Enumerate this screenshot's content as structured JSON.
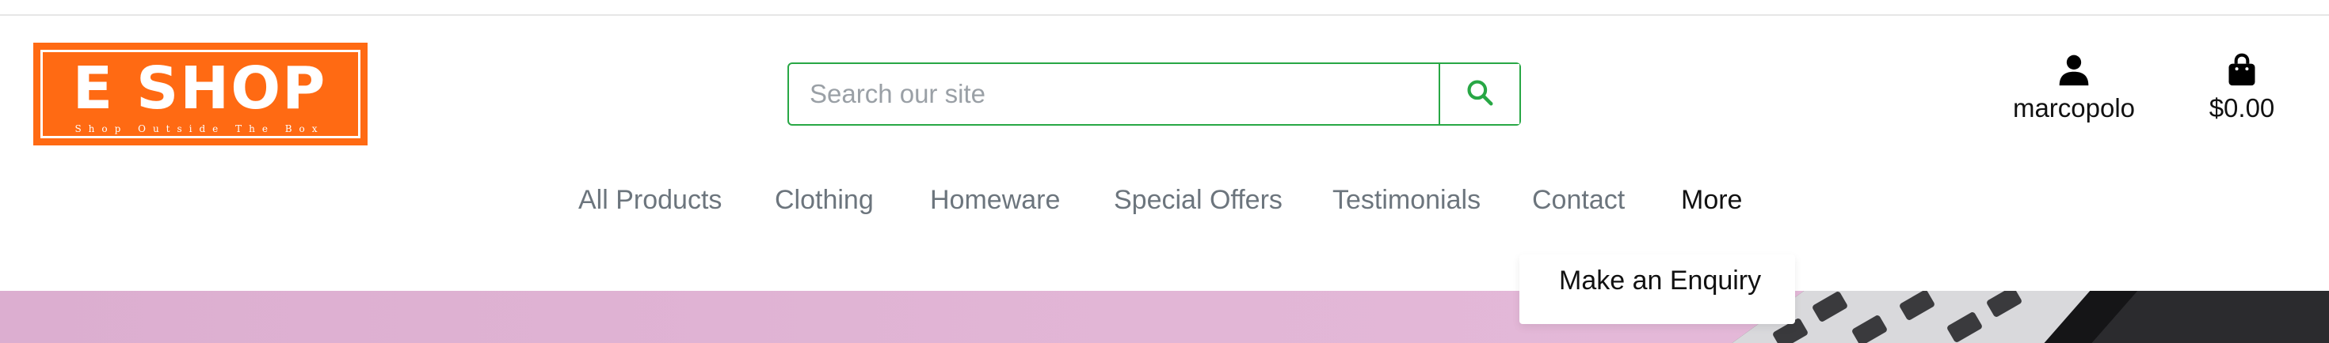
{
  "logo": {
    "title": "E SHOP",
    "tagline": "Shop Outside The Box",
    "brand_color": "#ff6a13"
  },
  "search": {
    "placeholder": "Search our site",
    "value": "",
    "button_icon": "search-icon",
    "accent_color": "#28a745"
  },
  "account": {
    "icon": "user-icon",
    "label": "marcopolo"
  },
  "cart": {
    "icon": "shopping-bag-icon",
    "total": "$0.00"
  },
  "nav": {
    "items": [
      {
        "label": "All Products"
      },
      {
        "label": "Clothing"
      },
      {
        "label": "Homeware"
      },
      {
        "label": "Special Offers"
      },
      {
        "label": "Testimonials"
      },
      {
        "label": "Contact"
      },
      {
        "label": "More"
      }
    ],
    "active_index": 6
  },
  "dropdown": {
    "items": [
      {
        "label": "Make an Enquiry"
      }
    ]
  },
  "hero": {
    "background_color": "#e2b6d6"
  }
}
